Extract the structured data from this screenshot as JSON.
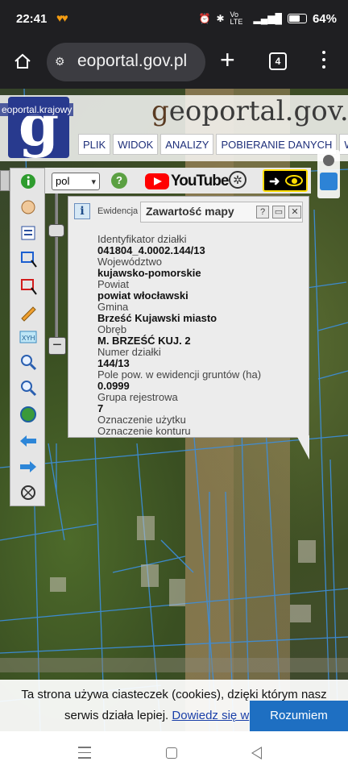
{
  "status_bar": {
    "time": "22:41",
    "notification_icons": "heart-icon",
    "network": "Vo LTE",
    "battery": "64%"
  },
  "browser": {
    "url": "eoportal.gov.pl",
    "tab_count": "4"
  },
  "geoportal": {
    "logo_letter": "g",
    "faded_header_text": "eoportal.krajowy",
    "site_title_g": "g",
    "site_title_rest": "eoportal.gov.pl",
    "menu": [
      "PLIK",
      "WIDOK",
      "ANALIZY",
      "POBIERANIE DANYCH",
      "WY"
    ]
  },
  "tools": {
    "language_value": "pol",
    "youtube_label": "YouTube"
  },
  "popup": {
    "source_label": "Ewidencja",
    "tab_title": "Zawartość mapy",
    "help_label": "?",
    "fields": [
      {
        "label": "Identyfikator działki",
        "value": "041804_4.0002.144/13"
      },
      {
        "label": "Województwo",
        "value": "kujawsko-pomorskie"
      },
      {
        "label": "Powiat",
        "value": "powiat włocławski"
      },
      {
        "label": "Gmina",
        "value": "Brześć Kujawski miasto"
      },
      {
        "label": "Obręb",
        "value": "M. BRZEŚĆ KUJ. 2"
      },
      {
        "label": "Numer działki",
        "value": "144/13"
      },
      {
        "label": "Pole pow. w ewidencji gruntów (ha)",
        "value": "0.0999"
      },
      {
        "label": "Grupa rejestrowa",
        "value": "7"
      },
      {
        "label": "Oznaczenie użytku",
        "value": ""
      },
      {
        "label": "Oznaczenie konturu",
        "value": ""
      }
    ]
  },
  "cookie": {
    "line1": "Ta strona używa ciasteczek (cookies), dzięki którym nasz",
    "line2": "serwis działa lepiej.",
    "link": "Dowiedz się w",
    "button": "Rozumiem"
  },
  "colors": {
    "geoportal_blue": "#283a8e",
    "cookie_button": "#1e6fc2",
    "browser_bg": "#1f1f22"
  }
}
